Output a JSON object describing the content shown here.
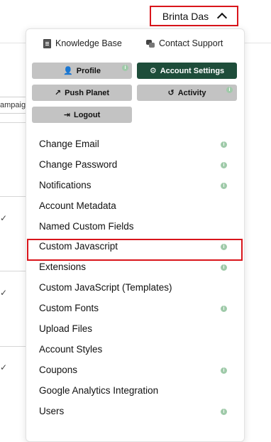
{
  "header": {
    "user_name": "Brinta Das"
  },
  "background": {
    "tab_label": "ampaig"
  },
  "dropdown": {
    "top_links": [
      {
        "label": "Knowledge Base",
        "icon": "knowledge-base-icon"
      },
      {
        "label": "Contact Support",
        "icon": "contact-support-icon"
      }
    ],
    "buttons": {
      "profile": "Profile",
      "account_settings": "Account Settings",
      "push_planet": "Push Planet",
      "activity": "Activity",
      "logout": "Logout"
    },
    "menu_items": [
      {
        "label": "Change Email",
        "info": true
      },
      {
        "label": "Change Password",
        "info": true
      },
      {
        "label": "Notifications",
        "info": true
      },
      {
        "label": "Account Metadata",
        "info": false
      },
      {
        "label": "Named Custom Fields",
        "info": false
      },
      {
        "label": "Custom Javascript",
        "info": true
      },
      {
        "label": "Extensions",
        "info": true
      },
      {
        "label": "Custom JavaScript (Templates)",
        "info": false
      },
      {
        "label": "Custom Fonts",
        "info": true
      },
      {
        "label": "Upload Files",
        "info": false
      },
      {
        "label": "Account Styles",
        "info": false
      },
      {
        "label": "Coupons",
        "info": true
      },
      {
        "label": "Google Analytics Integration",
        "info": false
      },
      {
        "label": "Users",
        "info": true
      }
    ],
    "highlighted_item": "Custom Javascript"
  },
  "colors": {
    "highlight_red": "#d9151b",
    "primary_green": "#1e4d3a",
    "button_gray": "#c3c3c3",
    "info_green": "#9fcaa9"
  }
}
